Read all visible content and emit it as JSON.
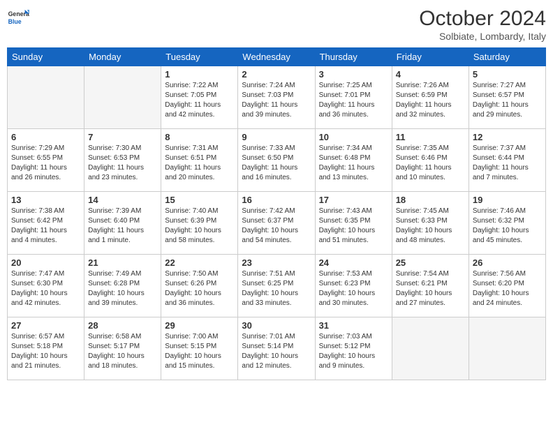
{
  "logo": {
    "general": "General",
    "blue": "Blue"
  },
  "header": {
    "month": "October 2024",
    "location": "Solbiate, Lombardy, Italy"
  },
  "days_of_week": [
    "Sunday",
    "Monday",
    "Tuesday",
    "Wednesday",
    "Thursday",
    "Friday",
    "Saturday"
  ],
  "weeks": [
    [
      {
        "day": "",
        "info": ""
      },
      {
        "day": "",
        "info": ""
      },
      {
        "day": "1",
        "info": "Sunrise: 7:22 AM\nSunset: 7:05 PM\nDaylight: 11 hours and 42 minutes."
      },
      {
        "day": "2",
        "info": "Sunrise: 7:24 AM\nSunset: 7:03 PM\nDaylight: 11 hours and 39 minutes."
      },
      {
        "day": "3",
        "info": "Sunrise: 7:25 AM\nSunset: 7:01 PM\nDaylight: 11 hours and 36 minutes."
      },
      {
        "day": "4",
        "info": "Sunrise: 7:26 AM\nSunset: 6:59 PM\nDaylight: 11 hours and 32 minutes."
      },
      {
        "day": "5",
        "info": "Sunrise: 7:27 AM\nSunset: 6:57 PM\nDaylight: 11 hours and 29 minutes."
      }
    ],
    [
      {
        "day": "6",
        "info": "Sunrise: 7:29 AM\nSunset: 6:55 PM\nDaylight: 11 hours and 26 minutes."
      },
      {
        "day": "7",
        "info": "Sunrise: 7:30 AM\nSunset: 6:53 PM\nDaylight: 11 hours and 23 minutes."
      },
      {
        "day": "8",
        "info": "Sunrise: 7:31 AM\nSunset: 6:51 PM\nDaylight: 11 hours and 20 minutes."
      },
      {
        "day": "9",
        "info": "Sunrise: 7:33 AM\nSunset: 6:50 PM\nDaylight: 11 hours and 16 minutes."
      },
      {
        "day": "10",
        "info": "Sunrise: 7:34 AM\nSunset: 6:48 PM\nDaylight: 11 hours and 13 minutes."
      },
      {
        "day": "11",
        "info": "Sunrise: 7:35 AM\nSunset: 6:46 PM\nDaylight: 11 hours and 10 minutes."
      },
      {
        "day": "12",
        "info": "Sunrise: 7:37 AM\nSunset: 6:44 PM\nDaylight: 11 hours and 7 minutes."
      }
    ],
    [
      {
        "day": "13",
        "info": "Sunrise: 7:38 AM\nSunset: 6:42 PM\nDaylight: 11 hours and 4 minutes."
      },
      {
        "day": "14",
        "info": "Sunrise: 7:39 AM\nSunset: 6:40 PM\nDaylight: 11 hours and 1 minute."
      },
      {
        "day": "15",
        "info": "Sunrise: 7:40 AM\nSunset: 6:39 PM\nDaylight: 10 hours and 58 minutes."
      },
      {
        "day": "16",
        "info": "Sunrise: 7:42 AM\nSunset: 6:37 PM\nDaylight: 10 hours and 54 minutes."
      },
      {
        "day": "17",
        "info": "Sunrise: 7:43 AM\nSunset: 6:35 PM\nDaylight: 10 hours and 51 minutes."
      },
      {
        "day": "18",
        "info": "Sunrise: 7:45 AM\nSunset: 6:33 PM\nDaylight: 10 hours and 48 minutes."
      },
      {
        "day": "19",
        "info": "Sunrise: 7:46 AM\nSunset: 6:32 PM\nDaylight: 10 hours and 45 minutes."
      }
    ],
    [
      {
        "day": "20",
        "info": "Sunrise: 7:47 AM\nSunset: 6:30 PM\nDaylight: 10 hours and 42 minutes."
      },
      {
        "day": "21",
        "info": "Sunrise: 7:49 AM\nSunset: 6:28 PM\nDaylight: 10 hours and 39 minutes."
      },
      {
        "day": "22",
        "info": "Sunrise: 7:50 AM\nSunset: 6:26 PM\nDaylight: 10 hours and 36 minutes."
      },
      {
        "day": "23",
        "info": "Sunrise: 7:51 AM\nSunset: 6:25 PM\nDaylight: 10 hours and 33 minutes."
      },
      {
        "day": "24",
        "info": "Sunrise: 7:53 AM\nSunset: 6:23 PM\nDaylight: 10 hours and 30 minutes."
      },
      {
        "day": "25",
        "info": "Sunrise: 7:54 AM\nSunset: 6:21 PM\nDaylight: 10 hours and 27 minutes."
      },
      {
        "day": "26",
        "info": "Sunrise: 7:56 AM\nSunset: 6:20 PM\nDaylight: 10 hours and 24 minutes."
      }
    ],
    [
      {
        "day": "27",
        "info": "Sunrise: 6:57 AM\nSunset: 5:18 PM\nDaylight: 10 hours and 21 minutes."
      },
      {
        "day": "28",
        "info": "Sunrise: 6:58 AM\nSunset: 5:17 PM\nDaylight: 10 hours and 18 minutes."
      },
      {
        "day": "29",
        "info": "Sunrise: 7:00 AM\nSunset: 5:15 PM\nDaylight: 10 hours and 15 minutes."
      },
      {
        "day": "30",
        "info": "Sunrise: 7:01 AM\nSunset: 5:14 PM\nDaylight: 10 hours and 12 minutes."
      },
      {
        "day": "31",
        "info": "Sunrise: 7:03 AM\nSunset: 5:12 PM\nDaylight: 10 hours and 9 minutes."
      },
      {
        "day": "",
        "info": ""
      },
      {
        "day": "",
        "info": ""
      }
    ]
  ]
}
